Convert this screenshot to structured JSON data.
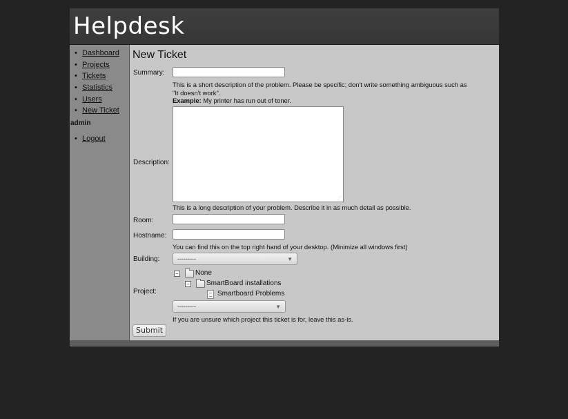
{
  "header": {
    "title": "Helpdesk"
  },
  "sidebar": {
    "items": [
      {
        "label": "Dashboard"
      },
      {
        "label": "Projects"
      },
      {
        "label": "Tickets"
      },
      {
        "label": "Statistics"
      },
      {
        "label": "Users"
      },
      {
        "label": "New Ticket"
      }
    ],
    "user": "admin",
    "user_items": [
      {
        "label": "Logout"
      }
    ]
  },
  "form": {
    "title": "New Ticket",
    "summary": {
      "label": "Summary:",
      "value": "",
      "help_line1": "This is a short description of the problem. Please be specific; don't write something ambiguous such as",
      "help_line2": "\"It doesn't work\".",
      "example_label": "Example:",
      "example_text": " My printer has run out of toner."
    },
    "description": {
      "label": "Description:",
      "value": "",
      "help": "This is a long description of your problem. Describe it in as much detail as possible."
    },
    "room": {
      "label": "Room:",
      "value": ""
    },
    "hostname": {
      "label": "Hostname:",
      "value": "",
      "help": "You can find this on the top right hand of your desktop. (Minimize all windows first)"
    },
    "building": {
      "label": "Building:",
      "selected": "---------"
    },
    "project": {
      "label": "Project:",
      "tree": [
        {
          "label": "None",
          "type": "folder",
          "toggle": "−"
        },
        {
          "label": "SmartBoard installations",
          "type": "folder",
          "toggle": "−"
        },
        {
          "label": "Smartboard Problems",
          "type": "document"
        }
      ],
      "selected": "---------",
      "help": "If you are unsure which project this ticket is for, leave this as-is."
    },
    "submit_label": "Submit"
  }
}
